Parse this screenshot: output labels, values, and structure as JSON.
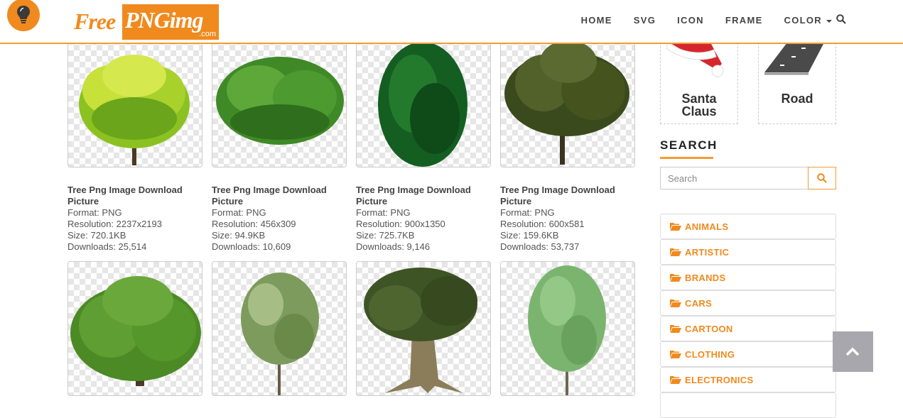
{
  "header": {
    "logo_free": "Free",
    "logo_png": "PNGimg",
    "logo_com": ".com",
    "nav": [
      "HOME",
      "SVG",
      "ICON",
      "FRAME",
      "COLOR"
    ]
  },
  "cards_row1": [
    {
      "title": "Tree Png Image Download Picture",
      "format": "Format: PNG",
      "resolution": "Resolution: 2237x2193",
      "size": "Size: 720.1KB",
      "downloads": "Downloads: 25,514"
    },
    {
      "title": "Tree Png Image Download Picture",
      "format": "Format: PNG",
      "resolution": "Resolution: 456x309",
      "size": "Size: 94.9KB",
      "downloads": "Downloads: 10,609"
    },
    {
      "title": "Tree Png Image Download Picture",
      "format": "Format: PNG",
      "resolution": "Resolution: 900x1350",
      "size": "Size: 725.7KB",
      "downloads": "Downloads: 9,146"
    },
    {
      "title": "Tree Png Image Download Picture",
      "format": "Format: PNG",
      "resolution": "Resolution: 600x581",
      "size": "Size: 159.6KB",
      "downloads": "Downloads: 53,737"
    }
  ],
  "sidebar": {
    "cards": [
      {
        "label_1": "Santa",
        "label_2": "Claus"
      },
      {
        "label": "Road"
      }
    ],
    "search_heading": "SEARCH",
    "search_placeholder": "Search",
    "categories": [
      "ANIMALS",
      "ARTISTIC",
      "BRANDS",
      "CARS",
      "CARTOON",
      "CLOTHING",
      "ELECTRONICS"
    ]
  },
  "colors": {
    "accent": "#f08a1e",
    "scroll_top": "#a7a7ad"
  },
  "icons": {
    "logo": "lightbulb-icon",
    "search": "search-icon",
    "category": "folder-open-icon",
    "back_to_top": "chevron-up-icon"
  }
}
